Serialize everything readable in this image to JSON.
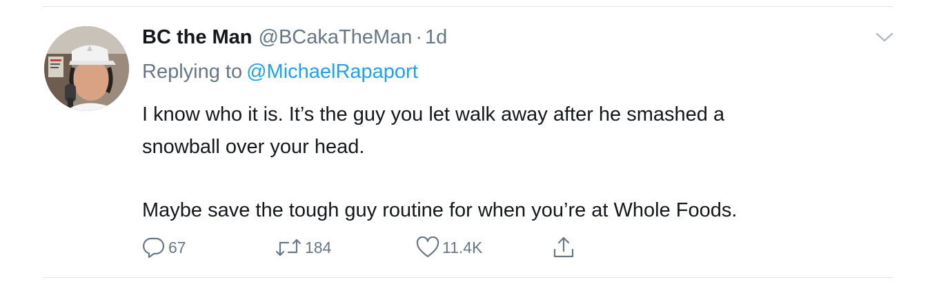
{
  "tweet": {
    "display_name": "BC the Man",
    "handle": "@BCakaTheMan",
    "separator": "·",
    "time": "1d",
    "replying_to_label": "Replying to",
    "replying_to_handle": "@MichaelRapaport",
    "text_lines": [
      "I know who it is. It’s the guy you let walk away after he smashed a",
      "snowball over your head.",
      "Maybe save the tough guy routine for when you’re at Whole Foods."
    ]
  },
  "actions": {
    "replies": "67",
    "retweets": "184",
    "likes": "11.4K"
  },
  "icons": {
    "reply": "reply-icon",
    "retweet": "retweet-icon",
    "like": "heart-icon",
    "share": "share-icon",
    "caret": "chevron-down-icon"
  },
  "colors": {
    "text": "#14171a",
    "secondary": "#657786",
    "link": "#1da1f2",
    "divider": "#dfe3e6"
  }
}
